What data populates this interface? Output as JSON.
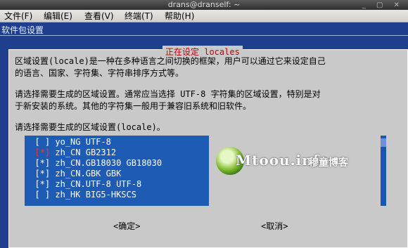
{
  "window": {
    "title": "drans@dranself: ~"
  },
  "menubar": {
    "items": [
      "文件(F)",
      "编辑(E)",
      "查看(V)",
      "终端(T)",
      "帮助(H)"
    ]
  },
  "terminal": {
    "header": "软件包设置"
  },
  "dialog": {
    "title": "正在设定 locales",
    "para1_line1": "区域设置(locale)是一种在多种语言之间切换的框架，用户可以通过它来设定自己",
    "para1_line2": "的语言、国家、字符集、字符串排序方式等。",
    "para2_line1": "请选择需要生成的区域设置。通常应当选择 UTF-8 字符集的区域设置，特别是对",
    "para2_line2": "于新安装的系统。其他的字符集一般用于兼容旧系统和旧软件。",
    "para3": "请选择需要生成的区域设置(locale)。",
    "locales": [
      {
        "check": "[ ]",
        "label": "yo_NG UTF-8"
      },
      {
        "check": "[*]",
        "label": "zh_CN GB2312"
      },
      {
        "check": "[*]",
        "label": "zh_CN.GB18030 GB18030"
      },
      {
        "check": "[*]",
        "label": "zh_CN.GBK GBK"
      },
      {
        "check": "[*]",
        "label": "zh_CN.UTF-8 UTF-8"
      },
      {
        "check": "[ ]",
        "label": "zh_HK BIG5-HKSCS"
      }
    ],
    "ok_label": "<确定>",
    "cancel_label": "<取消>"
  },
  "watermark": {
    "text": "Mtoou.info",
    "cn": "穆童博客"
  },
  "colors": {
    "terminal_bg": "#1f3f8e",
    "dialog_bg": "#c9c9c9",
    "list_bg": "#1e5bb4",
    "title_red": "#c0000a"
  }
}
